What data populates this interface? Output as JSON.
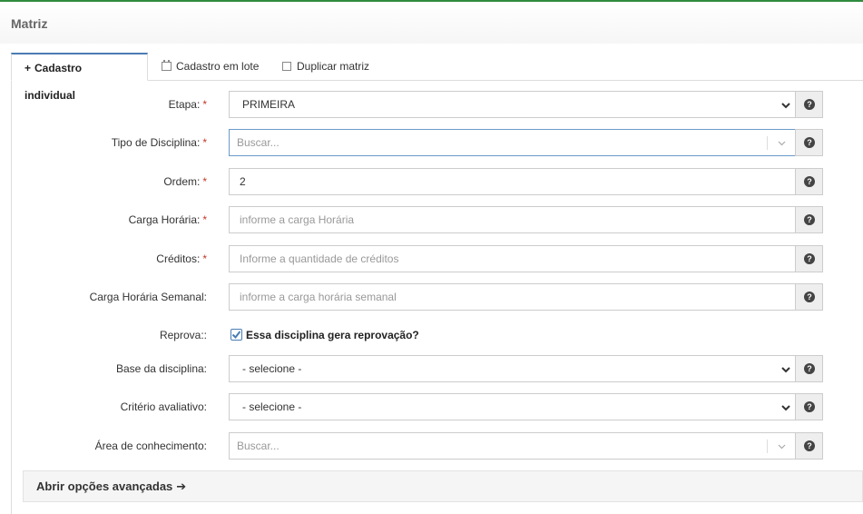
{
  "page": {
    "title": "Matriz"
  },
  "tabs": [
    {
      "label": "Cadastro individual",
      "icon": "plus-icon",
      "active": true
    },
    {
      "label": "Cadastro em lote",
      "icon": "calendar-icon",
      "active": false
    },
    {
      "label": "Duplicar matriz",
      "icon": "copy-icon",
      "active": false
    }
  ],
  "form": {
    "etapa": {
      "label": "Etapa:",
      "required": "*",
      "value": "PRIMEIRA"
    },
    "tipo_disciplina": {
      "label": "Tipo de Disciplina:",
      "required": "*",
      "placeholder": "Buscar..."
    },
    "ordem": {
      "label": "Ordem:",
      "required": "*",
      "value": "2"
    },
    "carga_horaria": {
      "label": "Carga Horária:",
      "required": "*",
      "placeholder": "informe a carga Horária"
    },
    "creditos": {
      "label": "Créditos:",
      "required": "*",
      "placeholder": "Informe a quantidade de créditos"
    },
    "carga_horaria_semanal": {
      "label": "Carga Horária Semanal:",
      "placeholder": "informe a carga horária semanal"
    },
    "reprova": {
      "label": "Reprova::",
      "checkbox_label": "Essa disciplina gera reprovação?",
      "checked": true
    },
    "base_disciplina": {
      "label": "Base da disciplina:",
      "value": "- selecione -"
    },
    "criterio_avaliativo": {
      "label": "Critério avaliativo:",
      "value": "- selecione -"
    },
    "area_conhecimento": {
      "label": "Área de conhecimento:",
      "placeholder": "Buscar..."
    },
    "help_glyph": "?"
  },
  "advanced": {
    "label": "Abrir opções avançadas",
    "arrow": "➔"
  },
  "colors": {
    "accent": "#4a7cb5",
    "top_bar": "#2e8b3e",
    "required": "#c0392b"
  }
}
